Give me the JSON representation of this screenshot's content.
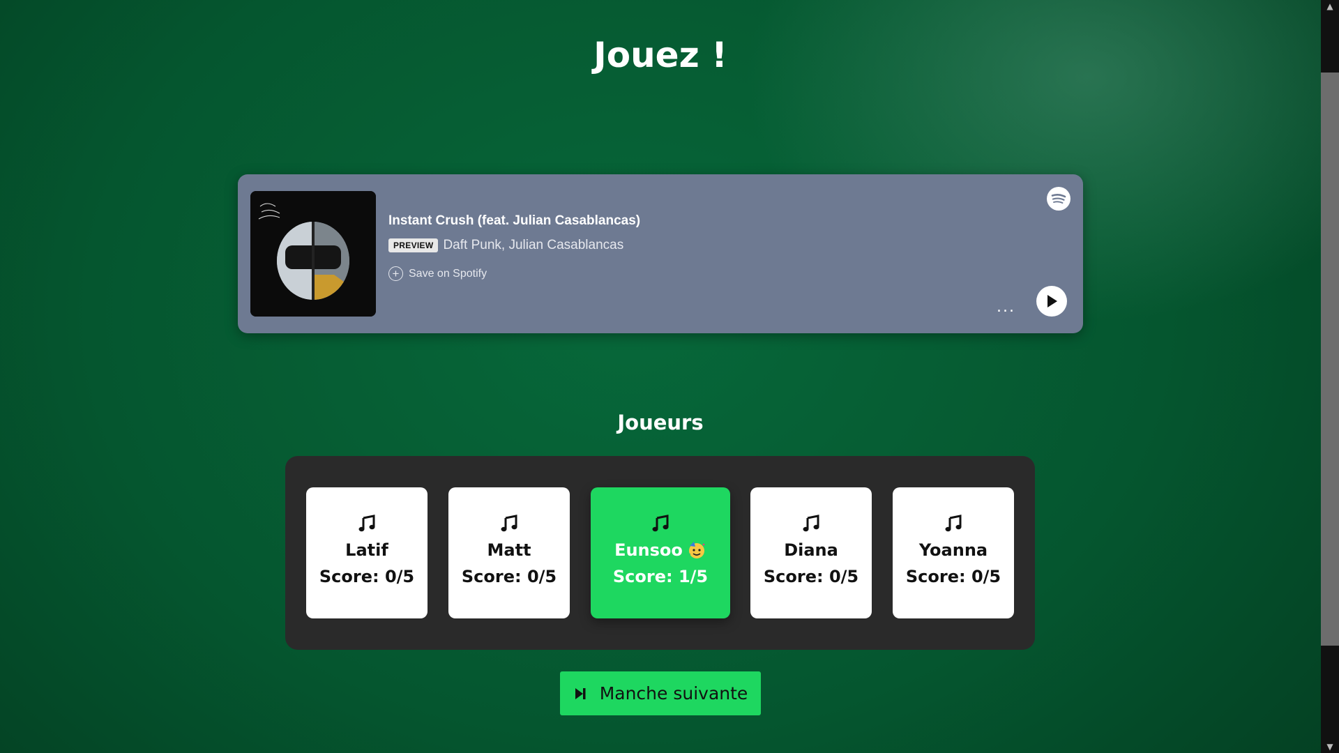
{
  "page": {
    "title": "Jouez !"
  },
  "player_embed": {
    "track_title": "Instant Crush (feat. Julian Casablancas)",
    "badge": "PREVIEW",
    "artists": "Daft Punk, Julian Casablancas",
    "save_label": "Save on Spotify",
    "more_label": "...",
    "icons": {
      "brand": "spotify-logo-icon",
      "play": "play-icon",
      "more": "more-options-icon",
      "save": "plus-circle-icon"
    }
  },
  "players": {
    "title": "Joueurs",
    "list": [
      {
        "name": "Latif",
        "score": "Score: 0/5",
        "active": false
      },
      {
        "name": "Matt",
        "score": "Score: 0/5",
        "active": false
      },
      {
        "name": "Eunsoo",
        "score": "Score: 1/5",
        "active": true,
        "emoji": "🥳"
      },
      {
        "name": "Diana",
        "score": "Score: 0/5",
        "active": false
      },
      {
        "name": "Yoanna",
        "score": "Score: 0/5",
        "active": false
      }
    ]
  },
  "next_round": {
    "label": "Manche suivante",
    "icon": "skip-next-icon"
  },
  "colors": {
    "accent": "#1ed760",
    "embed_bg": "#6e7a92",
    "panel_bg": "#2a2a2a",
    "background": "#05562f"
  }
}
